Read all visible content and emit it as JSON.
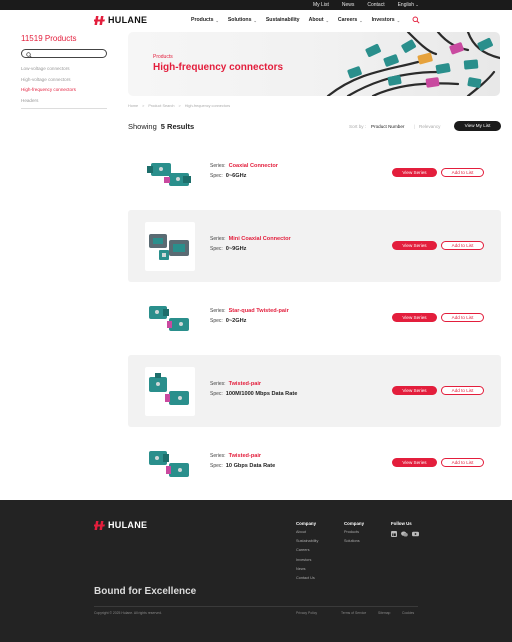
{
  "topbar": {
    "links": [
      "My List",
      "News",
      "Contact"
    ],
    "language": "English"
  },
  "header": {
    "logo_text": "HULANE",
    "nav": [
      "Products",
      "Solutions",
      "Sustainability",
      "About",
      "Careers",
      "Investors"
    ]
  },
  "sidebar": {
    "title": "11519 Products",
    "search_placeholder": "",
    "items": [
      {
        "label": "Low-voltage connectors",
        "active": false
      },
      {
        "label": "High-voltage connectors",
        "active": false
      },
      {
        "label": "High-frequency connectors",
        "active": true
      },
      {
        "label": "Headers",
        "active": false
      }
    ]
  },
  "banner": {
    "subtitle": "Products",
    "title": "High-frequency connectors"
  },
  "breadcrumb": [
    "Home",
    ">",
    "Product Search",
    ">",
    "High-frequency connectors"
  ],
  "results": {
    "showing_label": "Showing",
    "count_label": "5 Results",
    "sort_label": "Sort by :",
    "sort_options": [
      "Product Number",
      "Relevancy"
    ],
    "sort_separator": "|",
    "view_list_label": "View My List"
  },
  "products": [
    {
      "series_label": "Series:",
      "series": "Coaxial Connector",
      "spec_label": "Spec:",
      "spec": "0~6GHz",
      "view_label": "View Series",
      "add_label": "Add to List"
    },
    {
      "series_label": "Series:",
      "series": "Mini Coaxial Connector",
      "spec_label": "Spec:",
      "spec": "0~9GHz",
      "view_label": "View Series",
      "add_label": "Add to List"
    },
    {
      "series_label": "Series:",
      "series": "Star-quad Twisted-pair",
      "spec_label": "Spec:",
      "spec": "0~2GHz",
      "view_label": "View Series",
      "add_label": "Add to List"
    },
    {
      "series_label": "Series:",
      "series": "Twisted-pair",
      "spec_label": "Spec:",
      "spec": "100M/1000 Mbps Data Rate",
      "view_label": "View Series",
      "add_label": "Add to List"
    },
    {
      "series_label": "Series:",
      "series": "Twisted-pair",
      "spec_label": "Spec:",
      "spec": "10 Gbps Data Rate",
      "view_label": "View Series",
      "add_label": "Add to List"
    }
  ],
  "footer": {
    "logo_text": "HULANE",
    "columns": [
      {
        "heading": "Company",
        "links": [
          "About",
          "Sustainability",
          "Careers",
          "Investors",
          "News",
          "Contact Us"
        ]
      },
      {
        "heading": "Company",
        "links": [
          "Products",
          "Solutions"
        ]
      },
      {
        "heading": "Follow Us",
        "links": []
      }
    ],
    "social_icons": [
      "linkedin-icon",
      "wechat-icon",
      "youtube-icon"
    ],
    "tagline": "Bound for Excellence",
    "copyright": "Copyright © 2025 Hulane. All rights reserved.",
    "legal": [
      "Privacy Policy",
      "Terms of Service",
      "Sitemap",
      "Cookies"
    ]
  },
  "colors": {
    "brand_red": "#e31e3c",
    "dark": "#1b1b1b",
    "teal": "#2a8f8c"
  }
}
